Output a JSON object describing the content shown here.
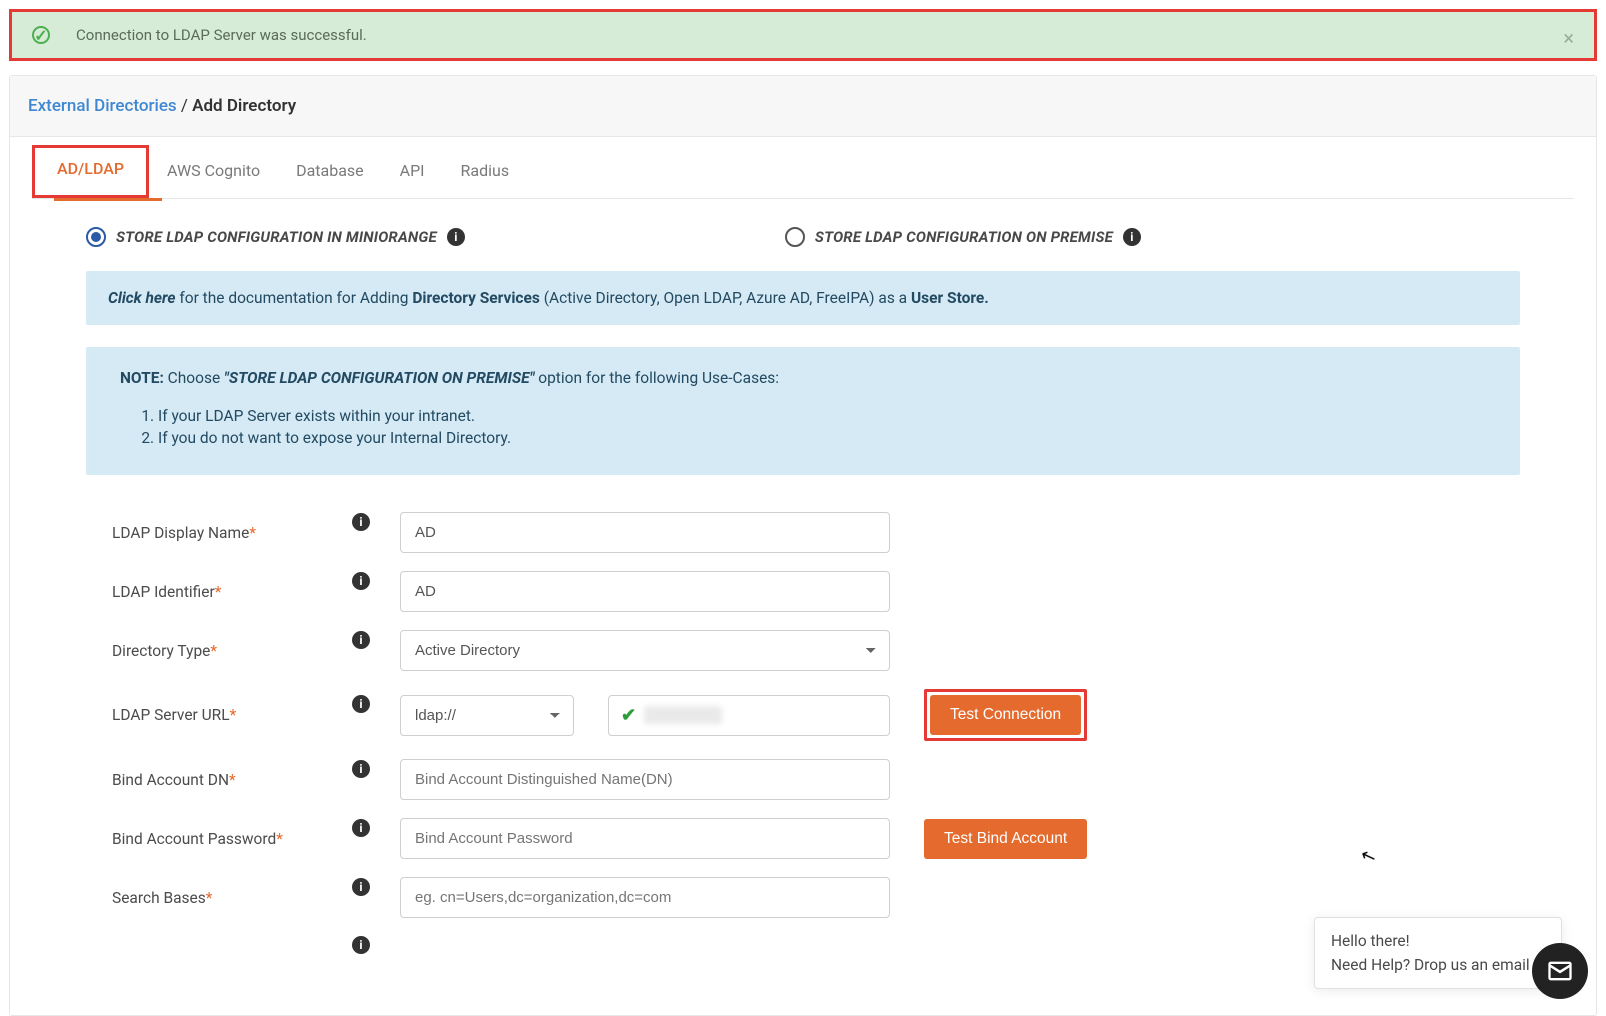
{
  "banner": {
    "message": "Connection to LDAP Server was successful."
  },
  "breadcrumb": {
    "parent": "External Directories",
    "separator": " / ",
    "current": "Add Directory"
  },
  "tabs": {
    "items": [
      "AD/LDAP",
      "AWS Cognito",
      "Database",
      "API",
      "Radius"
    ],
    "active": "AD/LDAP"
  },
  "radios": {
    "opt1": "STORE LDAP CONFIGURATION IN MINIORANGE",
    "opt2": "STORE LDAP CONFIGURATION ON PREMISE"
  },
  "infoBox": {
    "clickHere": "Click here",
    "text1": " for the documentation for Adding ",
    "dirServices": "Directory Services",
    "text2": " (Active Directory, Open LDAP, Azure AD, FreeIPA) as a ",
    "userStore": "User Store."
  },
  "noteBox": {
    "label": "NOTE:",
    "choose": "  Choose ",
    "emph": "\"STORE LDAP CONFIGURATION ON PREMISE\"",
    "tail": " option for the following Use-Cases:",
    "li1": "If your LDAP Server exists within your intranet.",
    "li2": "If you do not want to expose your Internal Directory."
  },
  "form": {
    "displayName": {
      "label": "LDAP Display Name",
      "value": "AD"
    },
    "identifier": {
      "label": "LDAP Identifier",
      "value": "AD"
    },
    "dirType": {
      "label": "Directory Type",
      "value": "Active Directory"
    },
    "serverUrl": {
      "label": "LDAP Server URL",
      "protocol": "ldap://"
    },
    "bindDn": {
      "label": "Bind Account DN",
      "placeholder": "Bind Account Distinguished Name(DN)"
    },
    "bindPw": {
      "label": "Bind Account Password",
      "placeholder": "Bind Account Password"
    },
    "searchBases": {
      "label": "Search Bases",
      "placeholder": "eg. cn=Users,dc=organization,dc=com"
    }
  },
  "buttons": {
    "testConn": "Test Connection",
    "testBind": "Test Bind Account"
  },
  "chat": {
    "line1": "Hello there!",
    "line2": "Need Help? Drop us an email !"
  }
}
